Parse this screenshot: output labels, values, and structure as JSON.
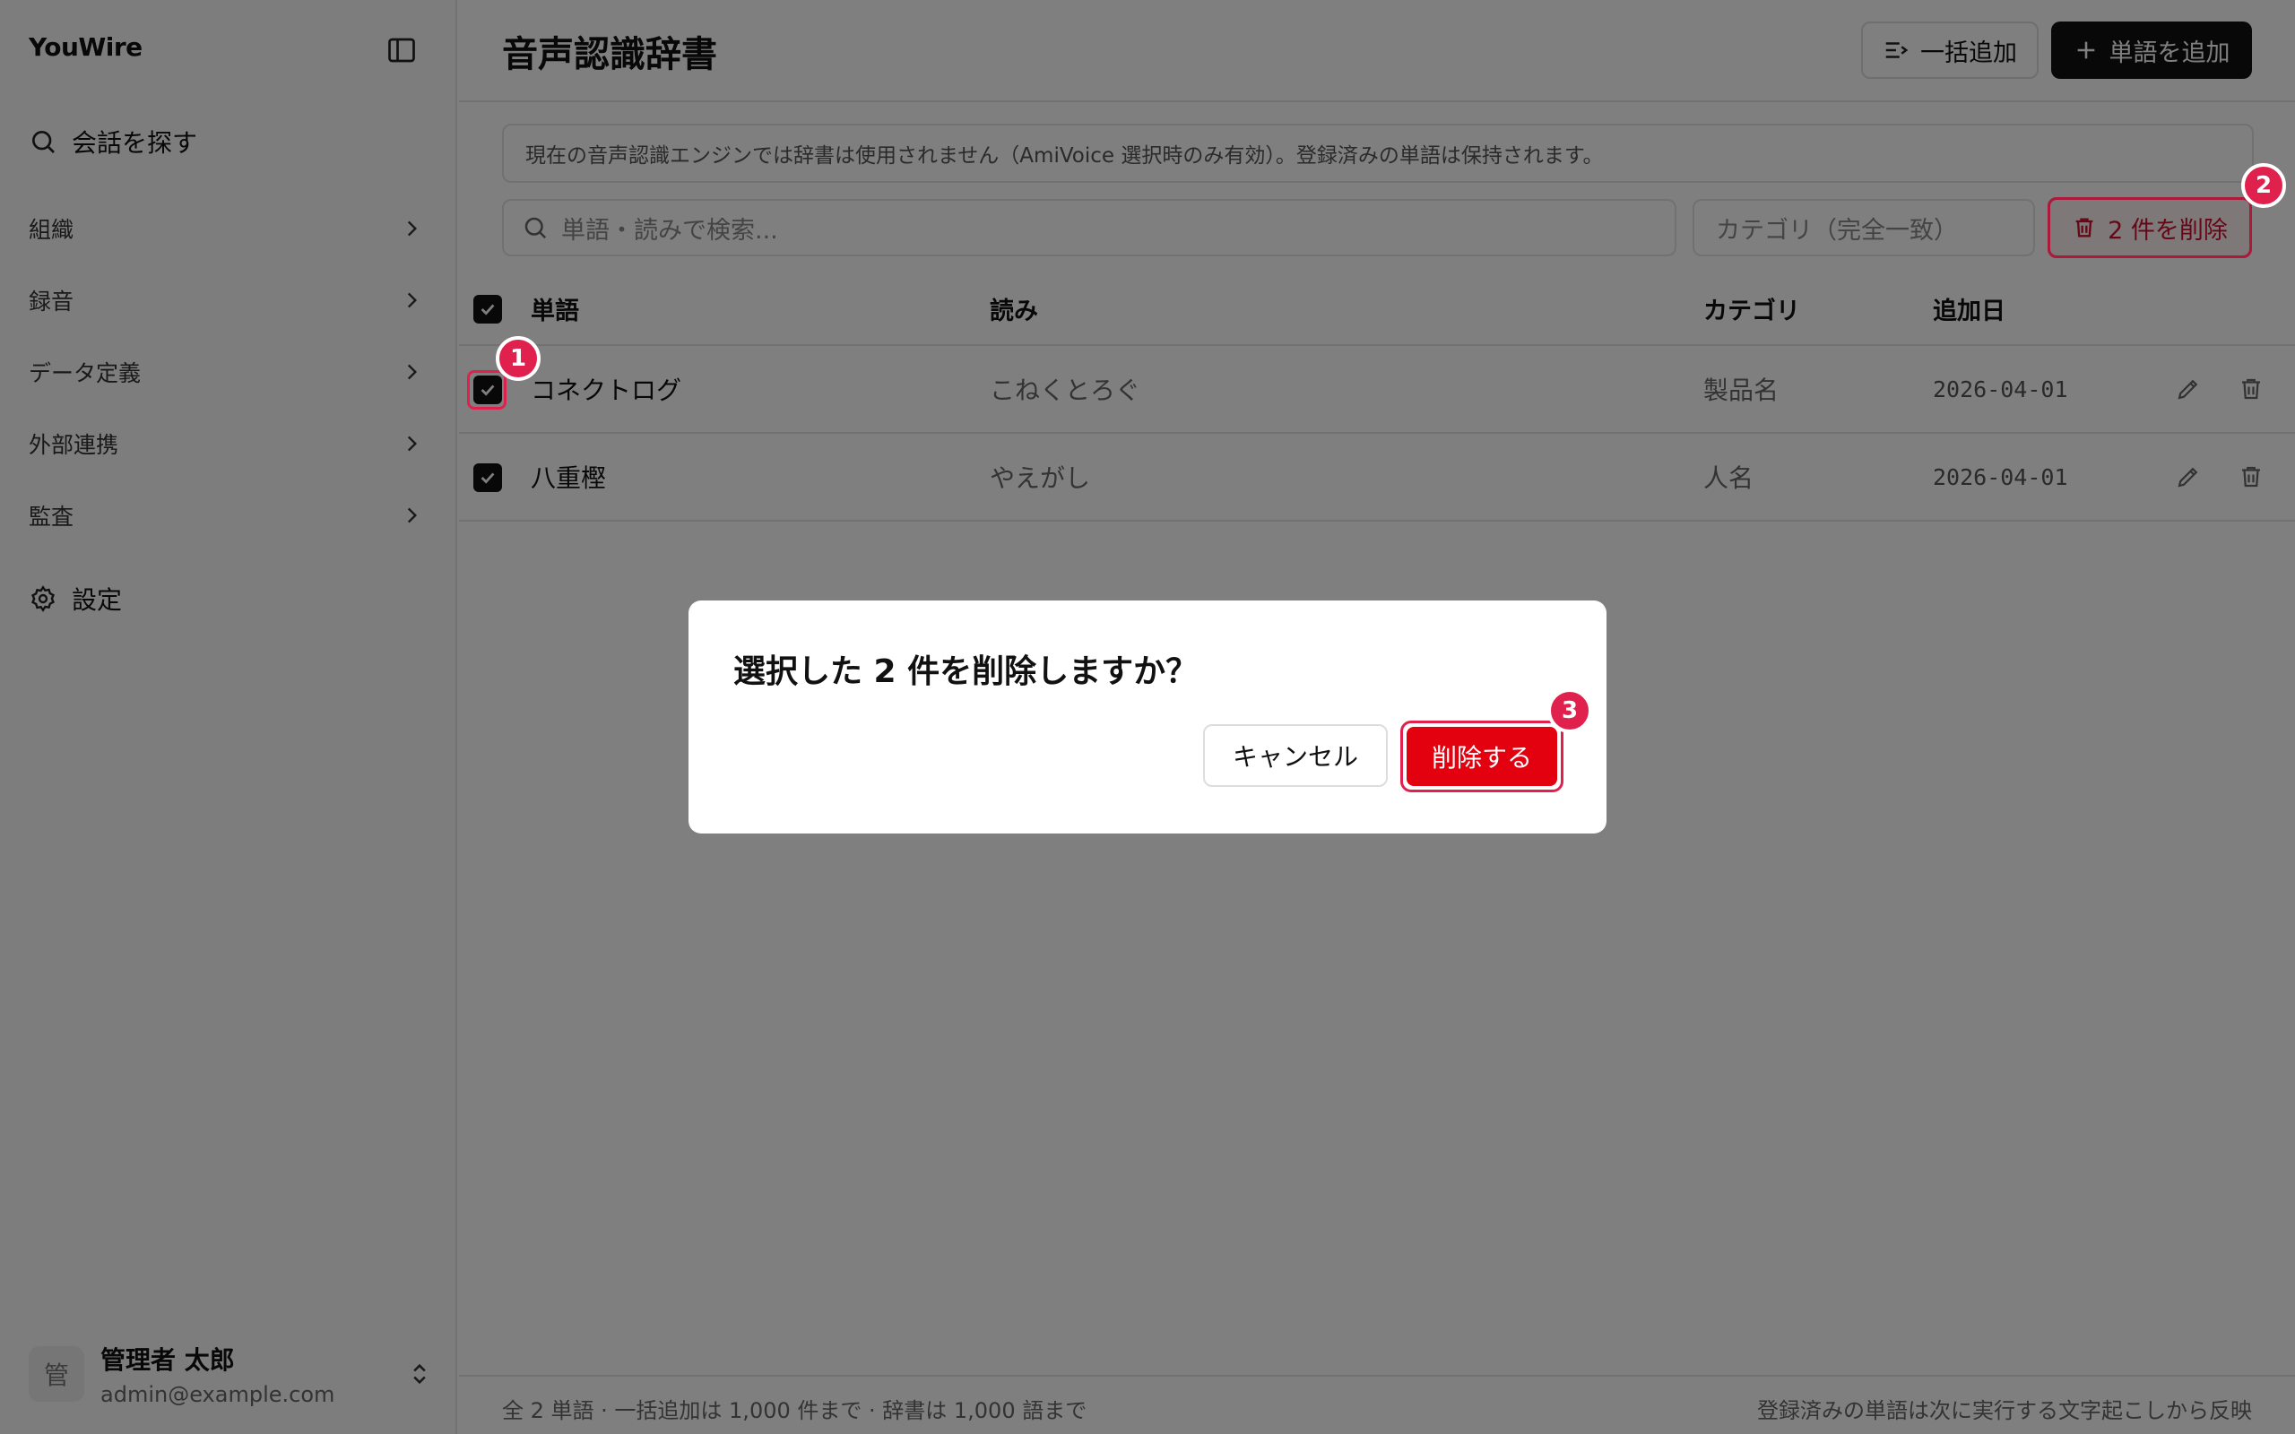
{
  "app": {
    "brand": "YouWire",
    "nav": {
      "search_label": "会話を探す",
      "items": [
        {
          "label": "組織"
        },
        {
          "label": "録音"
        },
        {
          "label": "データ定義"
        },
        {
          "label": "外部連携"
        },
        {
          "label": "監査"
        }
      ],
      "settings_label": "設定"
    },
    "user": {
      "avatar": "管",
      "name": "管理者 太郎",
      "email": "admin@example.com"
    }
  },
  "page": {
    "title": "音声認識辞書",
    "bulk_add_label": "一括追加",
    "add_word_label": "単語を追加",
    "notice": "現在の音声認識エンジンでは辞書は使用されません（AmiVoice 選択時のみ有効）。登録済みの単語は保持されます。",
    "search_placeholder": "単語・読みで検索...",
    "category_placeholder": "カテゴリ（完全一致）",
    "delete_selected_label": "2 件を削除",
    "table": {
      "headers": {
        "word": "単語",
        "reading": "読み",
        "category": "カテゴリ",
        "added": "追加日"
      },
      "rows": [
        {
          "word": "コネクトログ",
          "reading": "こねくとろぐ",
          "category": "製品名",
          "added": "2026-04-01"
        },
        {
          "word": "八重樫",
          "reading": "やえがし",
          "category": "人名",
          "added": "2026-04-01"
        }
      ]
    },
    "footer_left": "全 2 単語 · 一括追加は 1,000 件まで · 辞書は 1,000 語まで",
    "footer_right": "登録済みの単語は次に実行する文字起こしから反映"
  },
  "dialog": {
    "title": "選択した 2 件を削除しますか？",
    "cancel_label": "キャンセル",
    "confirm_label": "削除する"
  },
  "steps": [
    "1",
    "2",
    "3"
  ],
  "colors": {
    "accent": "#e0214d",
    "danger": "#e3000f",
    "primary": "#111111"
  }
}
